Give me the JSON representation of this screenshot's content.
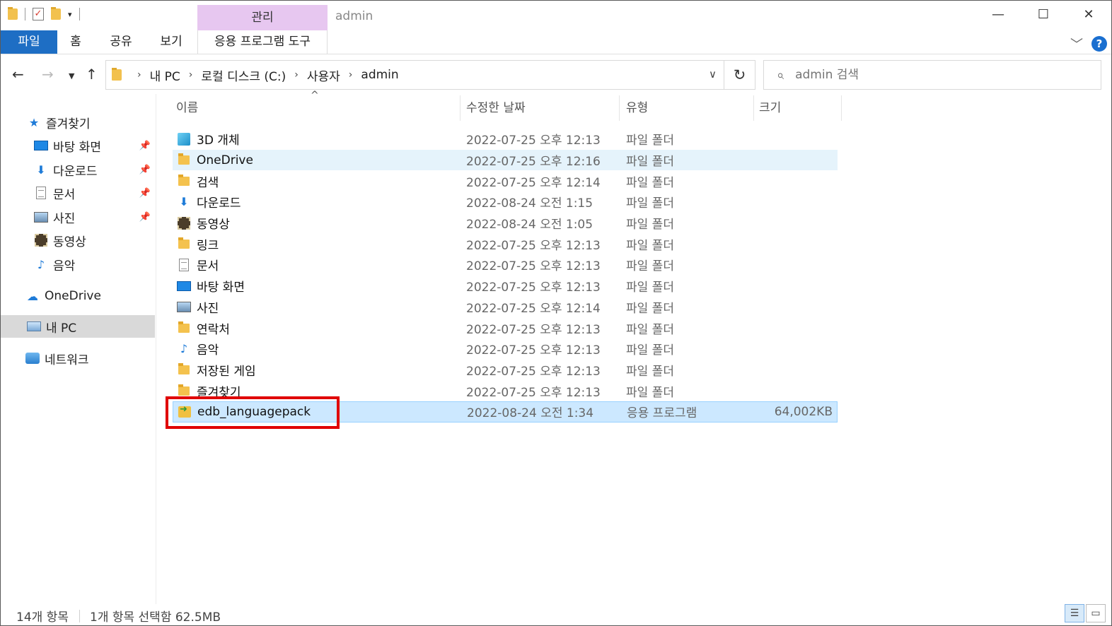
{
  "title_bar": {
    "context_tab": "관리",
    "window_title": "admin",
    "min_icon": "minimize-icon",
    "max_icon": "maximize-icon",
    "close_icon": "close-icon"
  },
  "ribbon": {
    "tabs": [
      "파일",
      "홈",
      "공유",
      "보기",
      "응용 프로그램 도구"
    ]
  },
  "address": {
    "crumbs": [
      "내 PC",
      "로컬 디스크 (C:)",
      "사용자",
      "admin"
    ],
    "search_placeholder": "admin 검색"
  },
  "sidebar": {
    "items": [
      {
        "label": "즐겨찾기",
        "icon": "star-icon"
      },
      {
        "label": "바탕 화면",
        "icon": "desktop-icon",
        "pinned": true
      },
      {
        "label": "다운로드",
        "icon": "download-icon",
        "pinned": true
      },
      {
        "label": "문서",
        "icon": "document-icon",
        "pinned": true
      },
      {
        "label": "사진",
        "icon": "picture-icon",
        "pinned": true
      },
      {
        "label": "동영상",
        "icon": "video-icon"
      },
      {
        "label": "음악",
        "icon": "music-icon"
      },
      {
        "label": "OneDrive",
        "icon": "cloud-icon"
      },
      {
        "label": "내 PC",
        "icon": "pc-icon",
        "selected": true
      },
      {
        "label": "네트워크",
        "icon": "network-icon"
      }
    ]
  },
  "columns": {
    "name": "이름",
    "date": "수정한 날짜",
    "type": "유형",
    "size": "크기"
  },
  "files": [
    {
      "name": "3D 개체",
      "date": "2022-07-25 오후 12:13",
      "type": "파일 폴더",
      "size": "",
      "icon": "3d-objects-icon"
    },
    {
      "name": "OneDrive",
      "date": "2022-07-25 오후 12:16",
      "type": "파일 폴더",
      "size": "",
      "icon": "onedrive-folder-icon"
    },
    {
      "name": "검색",
      "date": "2022-07-25 오후 12:14",
      "type": "파일 폴더",
      "size": "",
      "icon": "search-folder-icon"
    },
    {
      "name": "다운로드",
      "date": "2022-08-24 오전 1:15",
      "type": "파일 폴더",
      "size": "",
      "icon": "download-icon"
    },
    {
      "name": "동영상",
      "date": "2022-08-24 오전 1:05",
      "type": "파일 폴더",
      "size": "",
      "icon": "video-icon"
    },
    {
      "name": "링크",
      "date": "2022-07-25 오후 12:13",
      "type": "파일 폴더",
      "size": "",
      "icon": "links-folder-icon"
    },
    {
      "name": "문서",
      "date": "2022-07-25 오후 12:13",
      "type": "파일 폴더",
      "size": "",
      "icon": "document-icon"
    },
    {
      "name": "바탕 화면",
      "date": "2022-07-25 오후 12:13",
      "type": "파일 폴더",
      "size": "",
      "icon": "desktop-icon"
    },
    {
      "name": "사진",
      "date": "2022-07-25 오후 12:14",
      "type": "파일 폴더",
      "size": "",
      "icon": "picture-icon"
    },
    {
      "name": "연락처",
      "date": "2022-07-25 오후 12:13",
      "type": "파일 폴더",
      "size": "",
      "icon": "contacts-folder-icon"
    },
    {
      "name": "음악",
      "date": "2022-07-25 오후 12:13",
      "type": "파일 폴더",
      "size": "",
      "icon": "music-icon"
    },
    {
      "name": "저장된 게임",
      "date": "2022-07-25 오후 12:13",
      "type": "파일 폴더",
      "size": "",
      "icon": "saved-games-folder-icon"
    },
    {
      "name": "즐겨찾기",
      "date": "2022-07-25 오후 12:13",
      "type": "파일 폴더",
      "size": "",
      "icon": "favorites-folder-icon"
    },
    {
      "name": "edb_languagepack",
      "date": "2022-08-24 오전 1:34",
      "type": "응용 프로그램",
      "size": "64,002KB",
      "icon": "application-icon"
    }
  ],
  "status": {
    "item_count": "14개 항목",
    "selection": "1개 항목 선택함 62.5MB"
  },
  "colors": {
    "file_tab": "#1e6ec4",
    "context_tab": "#e7c7f0",
    "selection_bg": "#cce8ff",
    "hover_bg": "#e5f3fb",
    "annotation_box": "#e00000"
  }
}
